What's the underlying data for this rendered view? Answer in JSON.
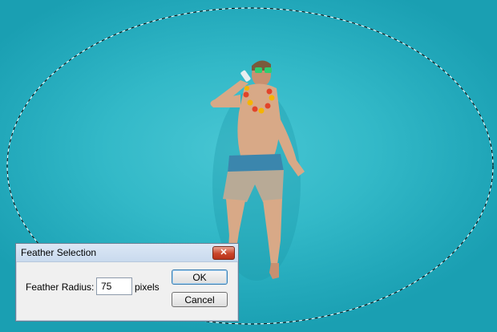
{
  "dialog": {
    "title": "Feather Selection",
    "close_label": "✕",
    "radius_label": "Feather Radius:",
    "radius_value": "75",
    "unit_label": "pixels",
    "ok_label": "OK",
    "cancel_label": "Cancel"
  },
  "colors": {
    "water": "#2bb3c4",
    "skin": "#d8a987",
    "shorts_blue": "#3b86ad",
    "shorts_khaki": "#b8aa96"
  }
}
